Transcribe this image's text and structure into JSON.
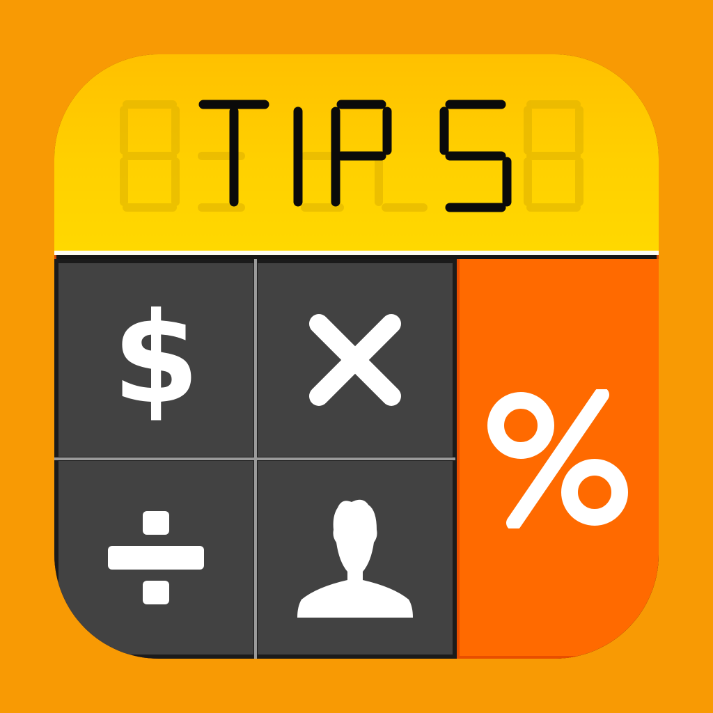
{
  "app_icon": {
    "display_text": "TIPS",
    "colors": {
      "background": "#F89A04",
      "display": "#FFD000",
      "segment_on": "#0A0A0A",
      "segment_off": "#E0B400",
      "key_dark": "#424242",
      "key_accent": "#FF6A00",
      "glyph": "#FFFFFF"
    },
    "keys": [
      {
        "icon": "dollar-icon"
      },
      {
        "icon": "multiply-icon"
      },
      {
        "icon": "percent-icon"
      },
      {
        "icon": "divide-icon"
      },
      {
        "icon": "person-icon"
      }
    ]
  }
}
